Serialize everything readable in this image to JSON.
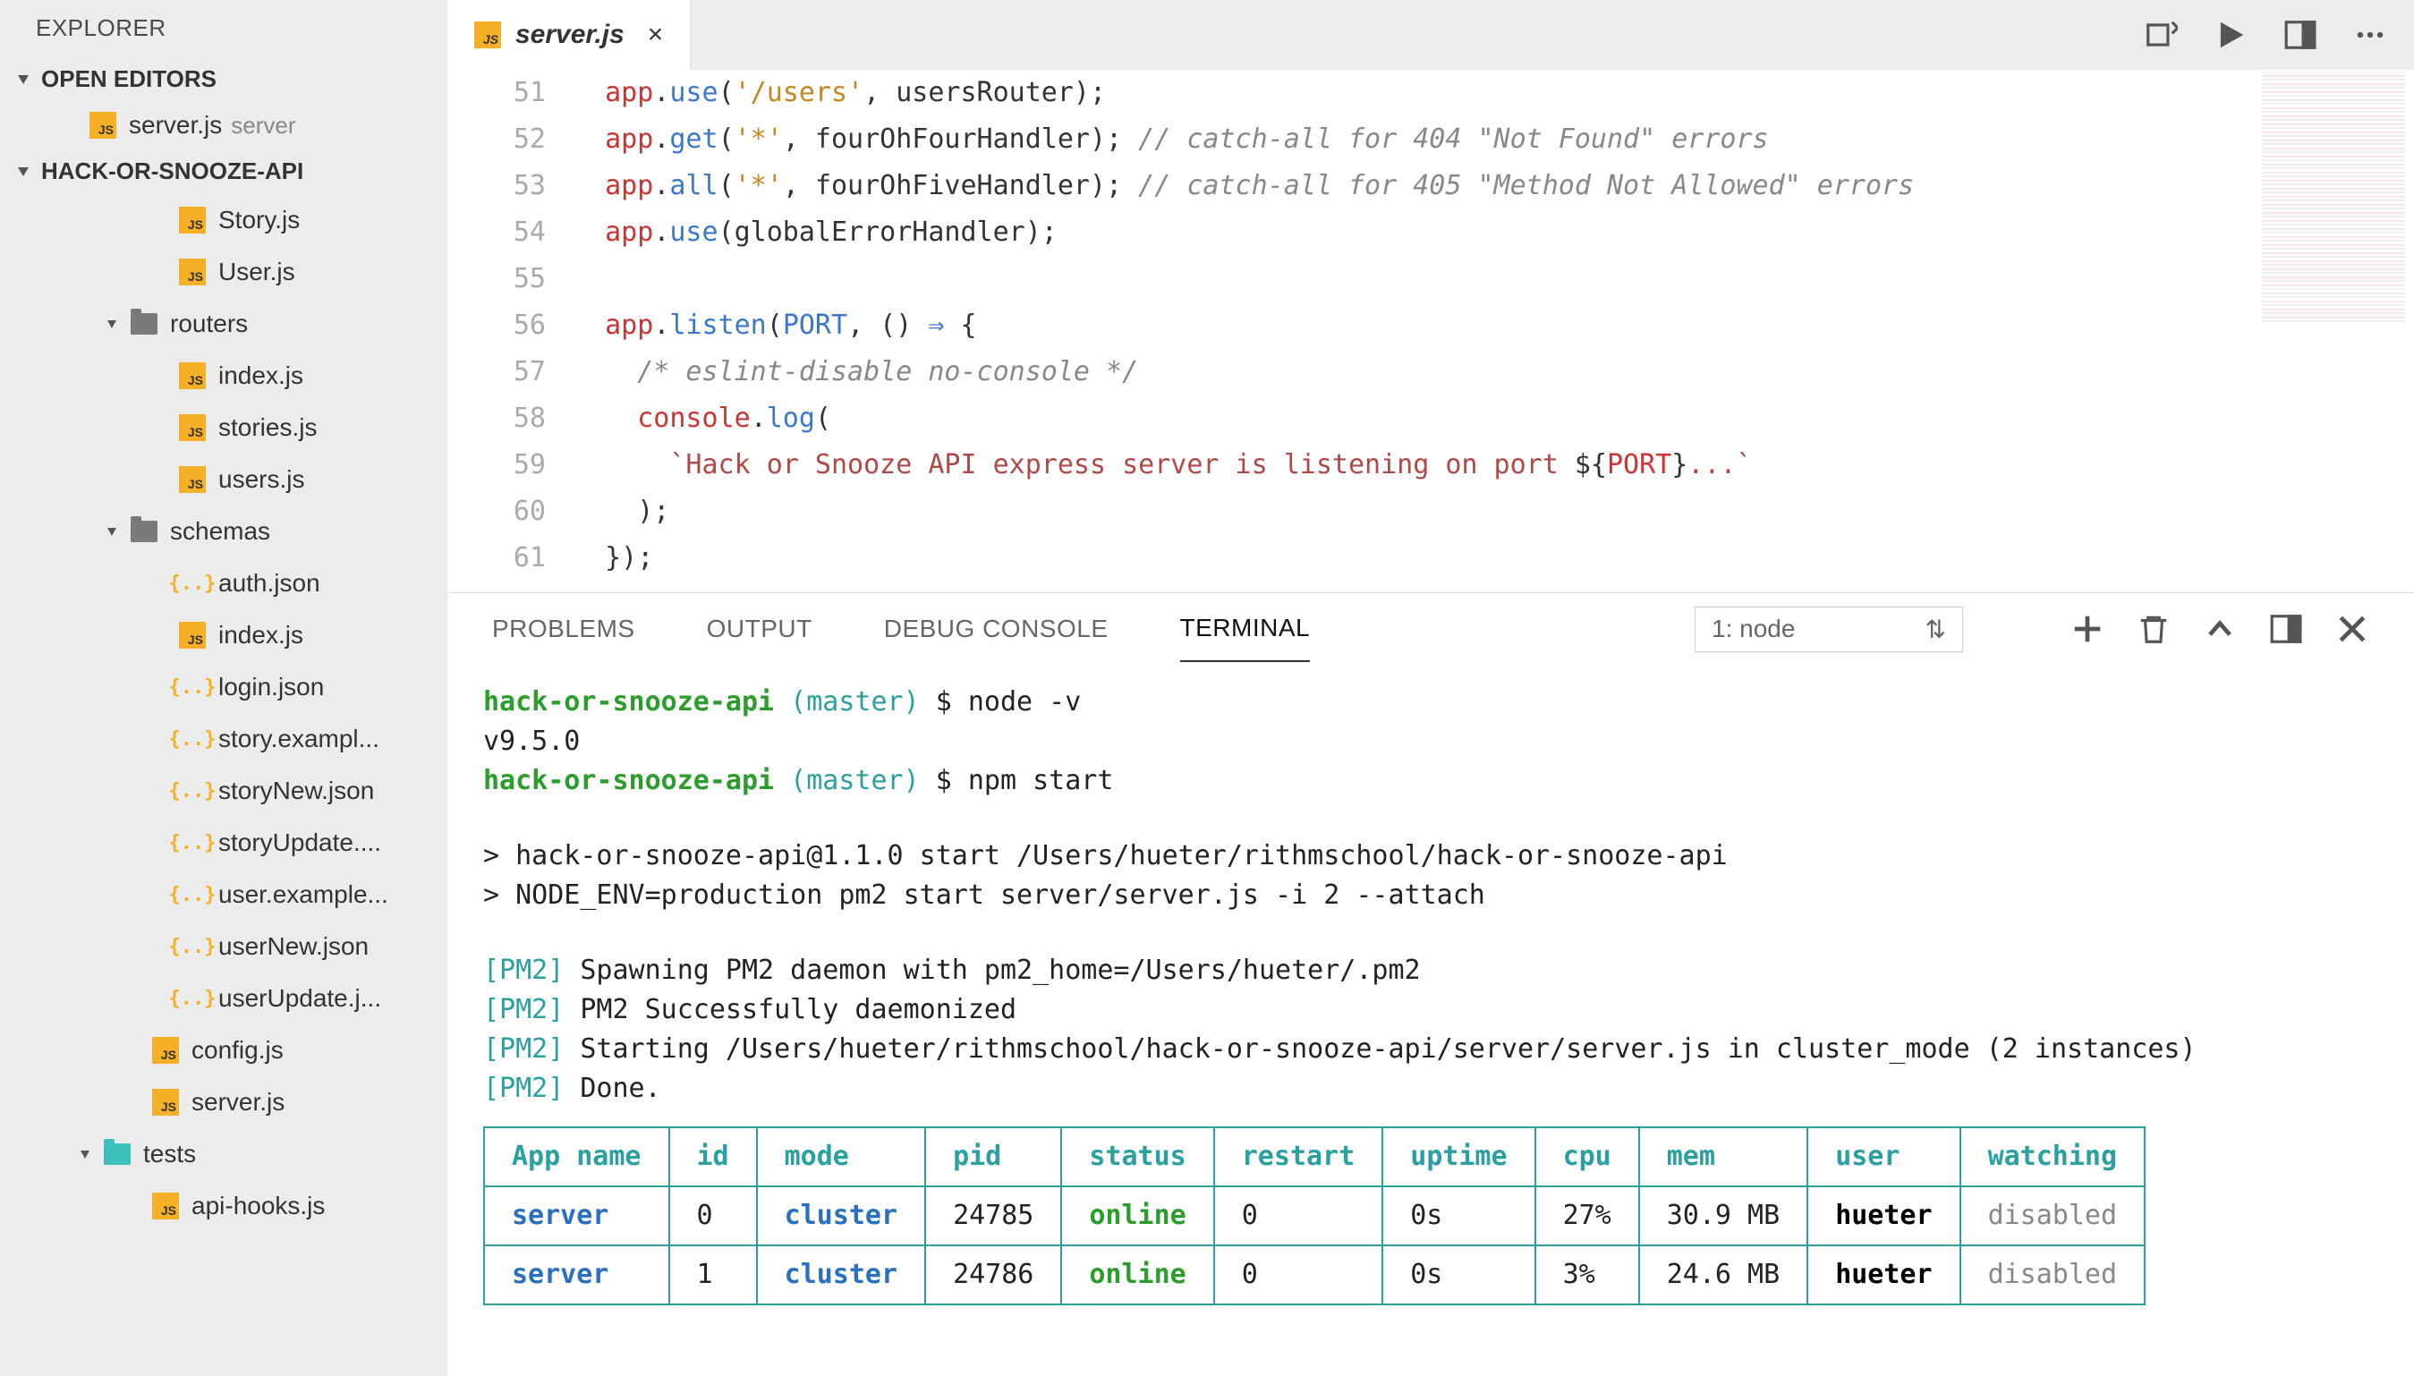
{
  "sidebar": {
    "title": "EXPLORER",
    "openEditors": {
      "label": "OPEN EDITORS",
      "items": [
        {
          "name": "server.js",
          "dir": "server"
        }
      ]
    },
    "project": {
      "label": "HACK-OR-SNOOZE-API",
      "tree": {
        "story": "Story.js",
        "user": "User.js",
        "routers": "routers",
        "routers_index": "index.js",
        "routers_stories": "stories.js",
        "routers_users": "users.js",
        "schemas": "schemas",
        "schemas_auth": "auth.json",
        "schemas_index": "index.js",
        "schemas_login": "login.json",
        "schemas_story_example": "story.exampl...",
        "schemas_storyNew": "storyNew.json",
        "schemas_storyUpdate": "storyUpdate....",
        "schemas_user_example": "user.example...",
        "schemas_userNew": "userNew.json",
        "schemas_userUpdate": "userUpdate.j...",
        "config": "config.js",
        "server": "server.js",
        "tests": "tests",
        "tests_apihooks": "api-hooks.js"
      }
    }
  },
  "tab": {
    "label": "server.js"
  },
  "code": {
    "lines": [
      {
        "n": "51",
        "html": "  <span class='tok-obj'>app</span>.<span class='tok-method'>use</span>(<span class='tok-str'>'/users'</span>, usersRouter);"
      },
      {
        "n": "52",
        "html": "  <span class='tok-obj'>app</span>.<span class='tok-method'>get</span>(<span class='tok-str'>'*'</span>, fourOhFourHandler); <span class='tok-comment'>// catch-all for 404 \"Not Found\" errors</span>"
      },
      {
        "n": "53",
        "html": "  <span class='tok-obj'>app</span>.<span class='tok-method'>all</span>(<span class='tok-str'>'*'</span>, fourOhFiveHandler); <span class='tok-comment'>// catch-all for 405 \"Method Not Allowed\" errors</span>"
      },
      {
        "n": "54",
        "html": "  <span class='tok-obj'>app</span>.<span class='tok-method'>use</span>(globalErrorHandler);"
      },
      {
        "n": "55",
        "html": ""
      },
      {
        "n": "56",
        "html": "  <span class='tok-obj'>app</span>.<span class='tok-method'>listen</span>(<span class='tok-const'>PORT</span>, () <span class='tok-arrow'>⇒</span> {"
      },
      {
        "n": "57",
        "html": "    <span class='tok-comment'>/* eslint-disable no-console */</span>"
      },
      {
        "n": "58",
        "html": "    <span class='tok-obj'>console</span>.<span class='tok-method'>log</span>("
      },
      {
        "n": "59",
        "html": "      <span class='tok-str-template'>`Hack or Snooze API express server is listening on port </span><span class='tok-punc'>${</span><span class='tok-interp'>PORT</span><span class='tok-punc'>}</span><span class='tok-str-template'>...`</span>"
      },
      {
        "n": "60",
        "html": "    );"
      },
      {
        "n": "61",
        "html": "  });"
      }
    ]
  },
  "panel": {
    "tabs": {
      "problems": "PROBLEMS",
      "output": "OUTPUT",
      "debug": "DEBUG CONSOLE",
      "terminal": "TERMINAL"
    },
    "selected": "1: node"
  },
  "terminal": {
    "prompt_repo": "hack-or-snooze-api",
    "prompt_branch": "(master)",
    "prompt_sym": "$",
    "cmd1": "node -v",
    "out1": "v9.5.0",
    "cmd2": "npm start",
    "start1": "> hack-or-snooze-api@1.1.0 start /Users/hueter/rithmschool/hack-or-snooze-api",
    "start2": "> NODE_ENV=production pm2 start server/server.js -i 2 --attach",
    "pm2_tag": "[PM2]",
    "pm2_1": "Spawning PM2 daemon with pm2_home=/Users/hueter/.pm2",
    "pm2_2": "PM2 Successfully daemonized",
    "pm2_3": "Starting /Users/hueter/rithmschool/hack-or-snooze-api/server/server.js in cluster_mode (2 instances)",
    "pm2_4": "Done.",
    "table": {
      "headers": [
        "App name",
        "id",
        "mode",
        "pid",
        "status",
        "restart",
        "uptime",
        "cpu",
        "mem",
        "user",
        "watching"
      ],
      "rows": [
        {
          "app": "server",
          "id": "0",
          "mode": "cluster",
          "pid": "24785",
          "status": "online",
          "restart": "0",
          "uptime": "0s",
          "cpu": "27%",
          "mem": "30.9 MB",
          "user": "hueter",
          "watching": "disabled"
        },
        {
          "app": "server",
          "id": "1",
          "mode": "cluster",
          "pid": "24786",
          "status": "online",
          "restart": "0",
          "uptime": "0s",
          "cpu": "3%",
          "mem": "24.6 MB",
          "user": "hueter",
          "watching": "disabled"
        }
      ]
    }
  }
}
